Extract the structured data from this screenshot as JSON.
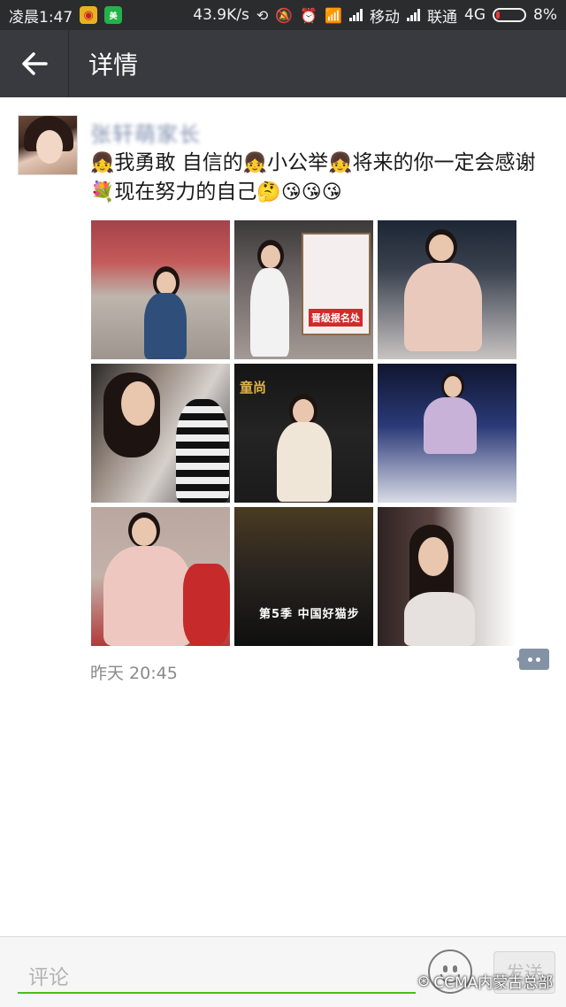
{
  "status_bar": {
    "time": "凌晨1:47",
    "speed": "43.9K/s",
    "carrier1": "移动",
    "carrier2": "联通",
    "network": "4G",
    "battery": "8%",
    "battery_level": 0.08
  },
  "header": {
    "title": "详情"
  },
  "post": {
    "username": "张轩萌家长",
    "text_parts": [
      "我勇敢 自信的",
      "小公举",
      "将来的你一定会感谢",
      "现在努力的自己"
    ],
    "emoji": {
      "girl": "👧",
      "flower": "💐",
      "thinking": "🤔",
      "kiss": "😘"
    },
    "timestamp": "昨天 20:45",
    "photos": [
      {
        "caption": ""
      },
      {
        "caption": "晋级报名处"
      },
      {
        "caption": ""
      },
      {
        "caption": ""
      },
      {
        "caption": "童尚"
      },
      {
        "caption": ""
      },
      {
        "caption": ""
      },
      {
        "caption": "第5季 中国好猫步"
      },
      {
        "caption": ""
      }
    ]
  },
  "bottom_bar": {
    "comment_placeholder": "评论",
    "send_label": "发送"
  },
  "watermark": "CCMA内蒙古总部",
  "colors": {
    "accent_green": "#45c01a",
    "title_bar": "#393a3f",
    "link_blue": "#576b95"
  }
}
